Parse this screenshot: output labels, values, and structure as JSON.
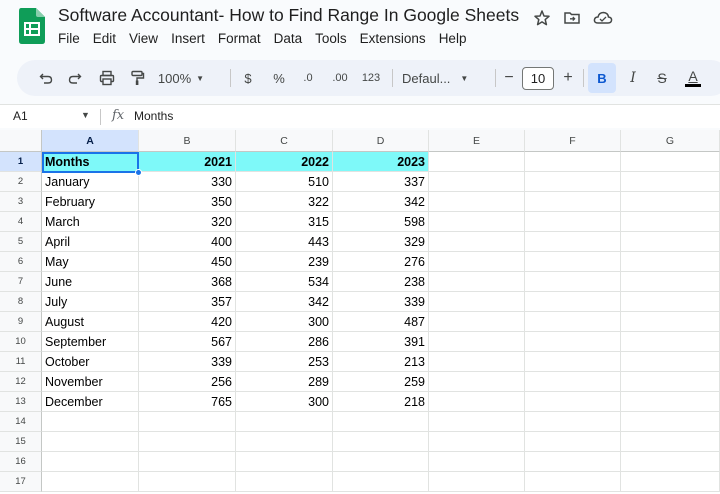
{
  "app": {
    "title": "Software Accountant- How to Find Range In Google Sheets",
    "icons": [
      "star-icon",
      "move-to-folder-icon",
      "cloud-saved-icon"
    ]
  },
  "menu": [
    "File",
    "Edit",
    "View",
    "Insert",
    "Format",
    "Data",
    "Tools",
    "Extensions",
    "Help"
  ],
  "toolbar": {
    "zoom": "100%",
    "currency": "$",
    "percent": "%",
    "decrease_decimal": ".0",
    "increase_decimal": ".00",
    "number_format": "123",
    "font": "Defaul...",
    "font_size": "10",
    "minus": "−",
    "plus": "+",
    "bold": "B",
    "italic": "I",
    "strike": "S",
    "text_color": "A",
    "text_color_value": "#000000"
  },
  "formula_bar": {
    "cell_ref": "A1",
    "fx": "fx",
    "value": "Months"
  },
  "grid": {
    "columns": [
      "A",
      "B",
      "C",
      "D",
      "E",
      "F",
      "G"
    ],
    "rows": [
      "1",
      "2",
      "3",
      "4",
      "5",
      "6",
      "7",
      "8",
      "9",
      "10",
      "11",
      "12",
      "13",
      "14",
      "15",
      "16",
      "17"
    ],
    "header": [
      "Months",
      "2021",
      "2022",
      "2023"
    ],
    "header_fill": "#7ef9f9",
    "data": [
      [
        "January",
        "330",
        "510",
        "337"
      ],
      [
        "February",
        "350",
        "322",
        "342"
      ],
      [
        "March",
        "320",
        "315",
        "598"
      ],
      [
        "April",
        "400",
        "443",
        "329"
      ],
      [
        "May",
        "450",
        "239",
        "276"
      ],
      [
        "June",
        "368",
        "534",
        "238"
      ],
      [
        "July",
        "357",
        "342",
        "339"
      ],
      [
        "August",
        "420",
        "300",
        "487"
      ],
      [
        "September",
        "567",
        "286",
        "391"
      ],
      [
        "October",
        "339",
        "253",
        "213"
      ],
      [
        "November",
        "256",
        "289",
        "259"
      ],
      [
        "December",
        "765",
        "300",
        "218"
      ]
    ]
  }
}
